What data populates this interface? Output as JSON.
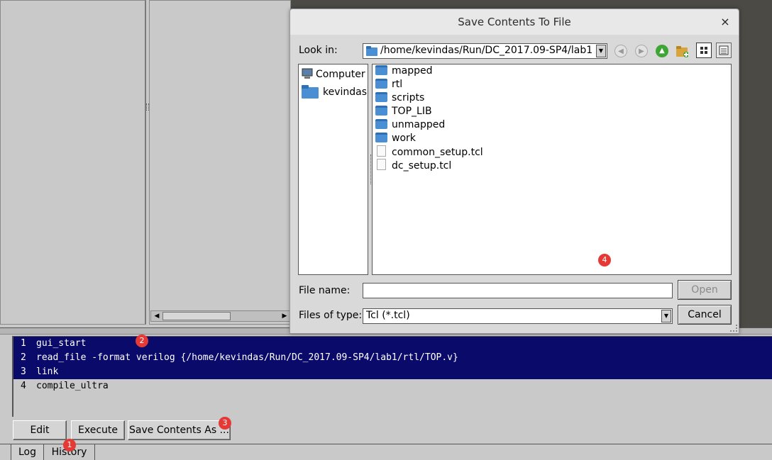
{
  "history": {
    "rows": [
      {
        "num": "1",
        "cmd": "gui_start",
        "selected": true
      },
      {
        "num": "2",
        "cmd": "read_file -format verilog {/home/kevindas/Run/DC_2017.09-SP4/lab1/rtl/TOP.v}",
        "selected": true
      },
      {
        "num": "3",
        "cmd": "link",
        "selected": true
      },
      {
        "num": "4",
        "cmd": "compile_ultra",
        "selected": false
      }
    ]
  },
  "buttons": {
    "edit": "Edit",
    "execute": "Execute",
    "save_as": "Save Contents As ..."
  },
  "tabs": {
    "log": "Log",
    "history": "History"
  },
  "badges": {
    "b1": "1",
    "b2": "2",
    "b3": "3",
    "b4": "4"
  },
  "dialog": {
    "title": "Save Contents To File",
    "close": "×",
    "look_in_label": "Look in:",
    "look_in_path": "/home/kevindas/Run/DC_2017.09-SP4/lab1",
    "sidebar": [
      "Computer",
      "kevindas"
    ],
    "files": [
      {
        "name": "mapped",
        "type": "folder"
      },
      {
        "name": "rtl",
        "type": "folder"
      },
      {
        "name": "scripts",
        "type": "folder"
      },
      {
        "name": "TOP_LIB",
        "type": "folder"
      },
      {
        "name": "unmapped",
        "type": "folder"
      },
      {
        "name": "work",
        "type": "folder"
      },
      {
        "name": "common_setup.tcl",
        "type": "file"
      },
      {
        "name": "dc_setup.tcl",
        "type": "file"
      }
    ],
    "file_name_label": "File name:",
    "file_name_value": "",
    "files_of_type_label": "Files of type:",
    "files_of_type_value": "Tcl (*.tcl)",
    "open_label": "Open",
    "cancel_label": "Cancel"
  },
  "colors": {
    "selection": "#0a0a6b",
    "badge": "#e53935",
    "folder": "#4a8fd4"
  }
}
